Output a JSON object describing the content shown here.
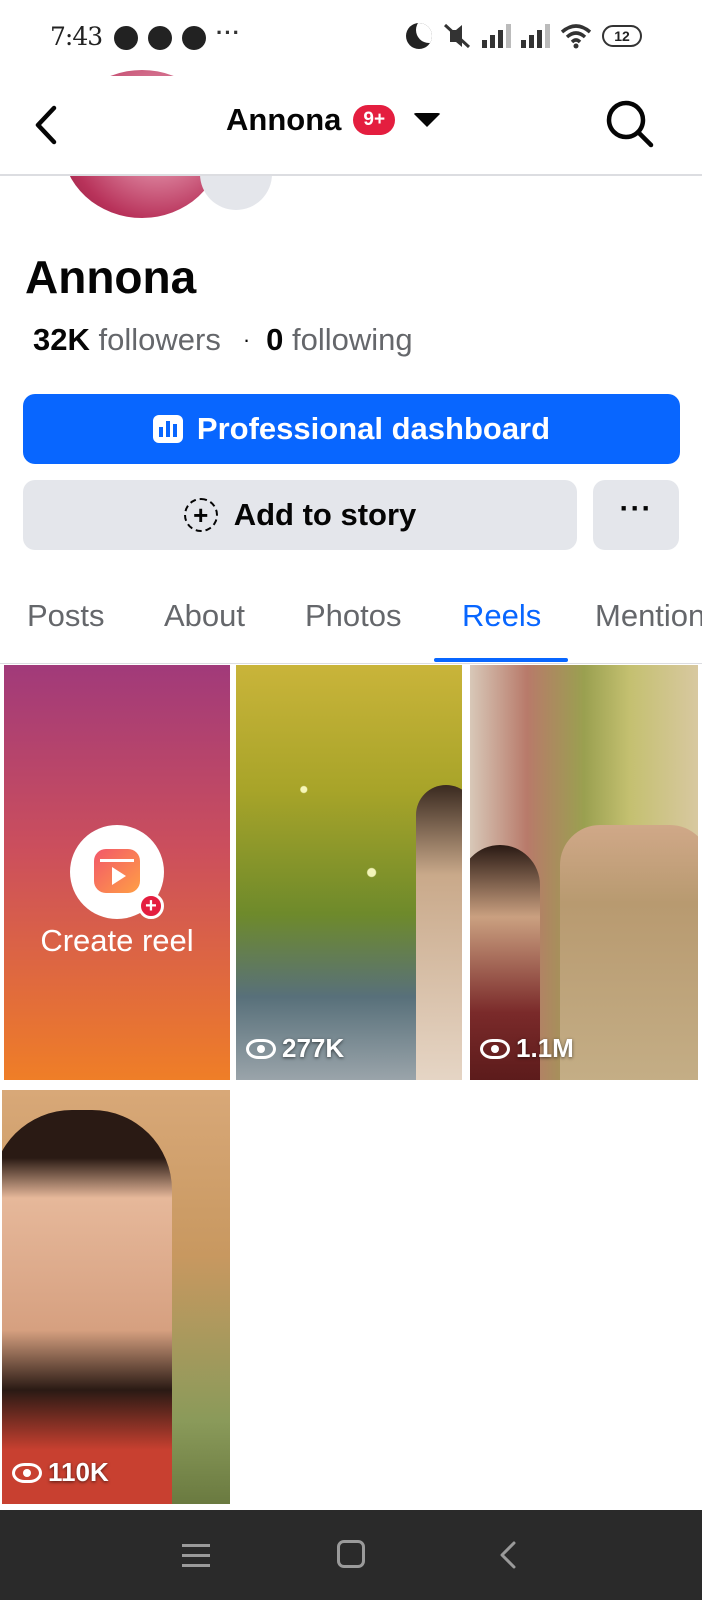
{
  "status_bar": {
    "time": "7:43",
    "battery": "12",
    "more": "···"
  },
  "header": {
    "title": "Annona",
    "badge": "9+"
  },
  "profile": {
    "name": "Annona",
    "followers_count": "32K",
    "followers_label": "followers",
    "separator": "·",
    "following_count": "0",
    "following_label": "following"
  },
  "actions": {
    "professional_dashboard": "Professional dashboard",
    "add_to_story": "Add to story",
    "more": "···"
  },
  "tabs": [
    {
      "label": "Posts",
      "active": false
    },
    {
      "label": "About",
      "active": false
    },
    {
      "label": "Photos",
      "active": false
    },
    {
      "label": "Reels",
      "active": true
    },
    {
      "label": "Mentions",
      "active": false
    }
  ],
  "reels": {
    "create_label": "Create reel",
    "items": [
      {
        "views": "277K"
      },
      {
        "views": "1.1M"
      },
      {
        "views": "110K"
      }
    ]
  },
  "colors": {
    "accent": "#0866ff",
    "badge": "#e41e3f",
    "button_gray": "#e4e6eb",
    "text_secondary": "#65676b"
  }
}
